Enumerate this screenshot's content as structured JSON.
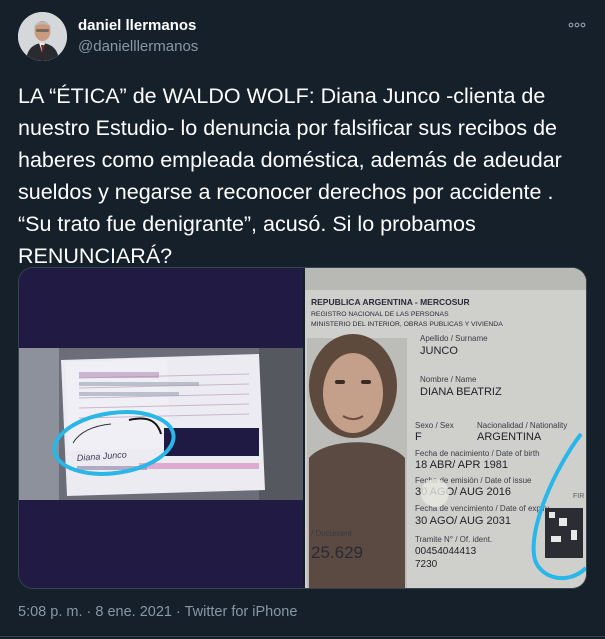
{
  "author": {
    "name": "daniel llermanos",
    "handle": "@danielllermanos",
    "avatar_icon": "person-avatar"
  },
  "more_icon": "more-horizontal-icon",
  "tweet": {
    "text": "LA “ÉTICA” de WALDO WOLF: Diana Junco -clienta de nuestro Estudio- lo denuncia por falsificar sus recibos de haberes como empleada doméstica, además de adeudar sueldos y negarse a reconocer derechos por accidente . “Su trato fue denigrante”, acusó. Si lo probamos RENUNCIARÁ?"
  },
  "media": {
    "left_photo": {
      "handwritten_signature": "Diana Junco"
    },
    "right_photo": {
      "header_line1": "REPUBLICA ARGENTINA - MERCOSUR",
      "header_line2": "REGISTRO NACIONAL DE LAS PERSONAS",
      "header_line3": "MINISTERIO DEL INTERIOR, OBRAS PUBLICAS Y VIVIENDA",
      "surname_label": "Apellido / Surname",
      "surname": "JUNCO",
      "name_label": "Nombre / Name",
      "given_name": "DIANA BEATRIZ",
      "sex_label": "Sexo / Sex",
      "sex": "F",
      "nationality_label": "Nacionalidad / Nationality",
      "nationality": "ARGENTINA",
      "dob_label": "Fecha de nacimiento / Date of birth",
      "dob": "18 ABR/ APR 1981",
      "issue_label": "Fecha de emisión / Date of issue",
      "issue_date": "30 AGO/ AUG 2016",
      "expiry_label": "Fecha de vencimiento / Date of expiry",
      "expiry_date": "30 AGO/ AUG 2031",
      "document_label": "/ Document",
      "document_number": "25.629",
      "tramite_label": "Tramite N° / Of. ident.",
      "tramite_number": "00454044413",
      "tramite_suffix": "7230",
      "side_text": "FIR"
    },
    "highlight_color": "#29b6e8"
  },
  "meta": {
    "time": "5:08 p. m.",
    "separator1": " · ",
    "date": "8 ene. 2021",
    "separator2": " · ",
    "source": "Twitter for iPhone"
  },
  "colors": {
    "background": "#15202b",
    "secondary_text": "#8899a6",
    "border": "#38444d"
  }
}
